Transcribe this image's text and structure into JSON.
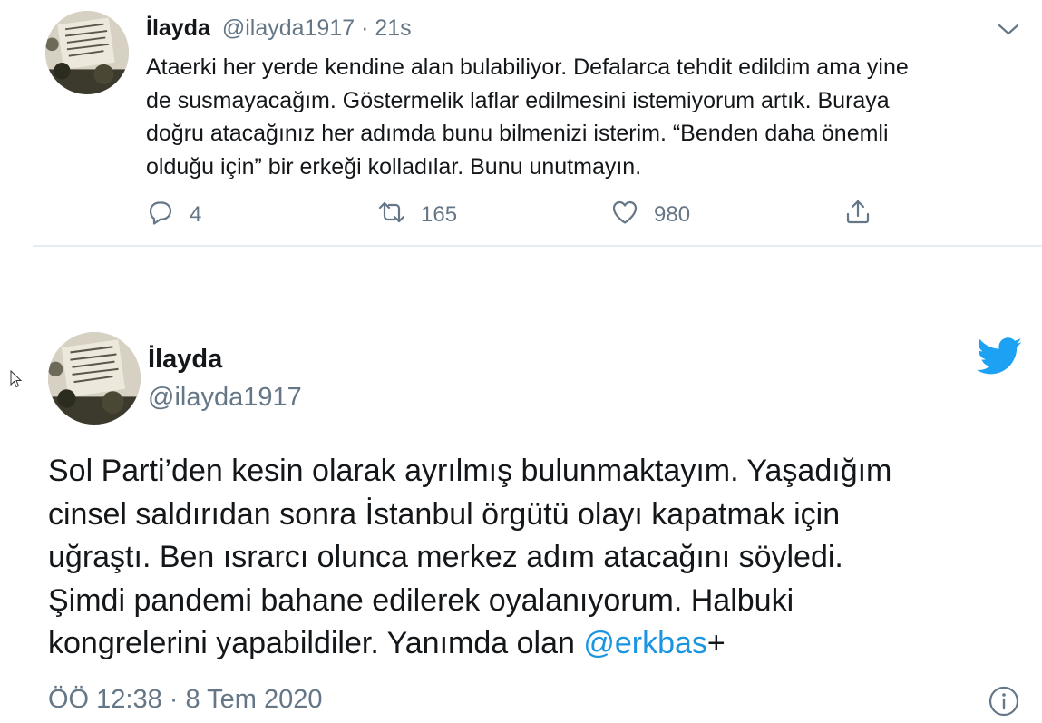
{
  "tweet1": {
    "display_name": "İlayda",
    "handle": "@ilayda1917",
    "separator": " · ",
    "time": "21s",
    "text_lines": [
      "Ataerki her yerde kendine alan bulabiliyor. Defalarca tehdit edildim ama yine",
      "de susmayacağım. Göstermelik laflar edilmesini istemiyorum artık. Buraya",
      "doğru atacağınız her adımda bunu bilmenizi isterim. “Benden daha önemli",
      "olduğu için” bir erkeği kolladılar. Bunu unutmayın."
    ],
    "actions": {
      "reply_count": "4",
      "retweet_count": "165",
      "like_count": "980"
    },
    "icons": {
      "menu": "chevron-down-icon",
      "reply": "reply-icon",
      "retweet": "retweet-icon",
      "like": "heart-icon",
      "share": "share-icon"
    }
  },
  "tweet2": {
    "display_name": "İlayda",
    "handle": "@ilayda1917",
    "text_lines": [
      "Sol Parti’den kesin olarak ayrılmış bulunmaktayım. Yaşadığım",
      "cinsel saldırıdan sonra İstanbul örgütü olayı kapatmak için",
      "uğraştı. Ben ısrarcı olunca merkez adım atacağını söyledi.",
      "Şimdi pandemi bahane edilerek oyalanıyorum. Halbuki"
    ],
    "last_line_prefix": "kongrelerini yapabildiler. Yanımda olan ",
    "mention": "@erkbas",
    "last_line_suffix": "+",
    "timestamp": "ÖÖ 12:38 · 8 Tem 2020",
    "icons": {
      "brand": "twitter-bird-icon",
      "info": "info-icon"
    }
  },
  "colors": {
    "text_primary": "#14171a",
    "text_secondary": "#657786",
    "link": "#1b95e0",
    "twitter_blue": "#1da1f2",
    "divider": "#e6ecf0"
  }
}
